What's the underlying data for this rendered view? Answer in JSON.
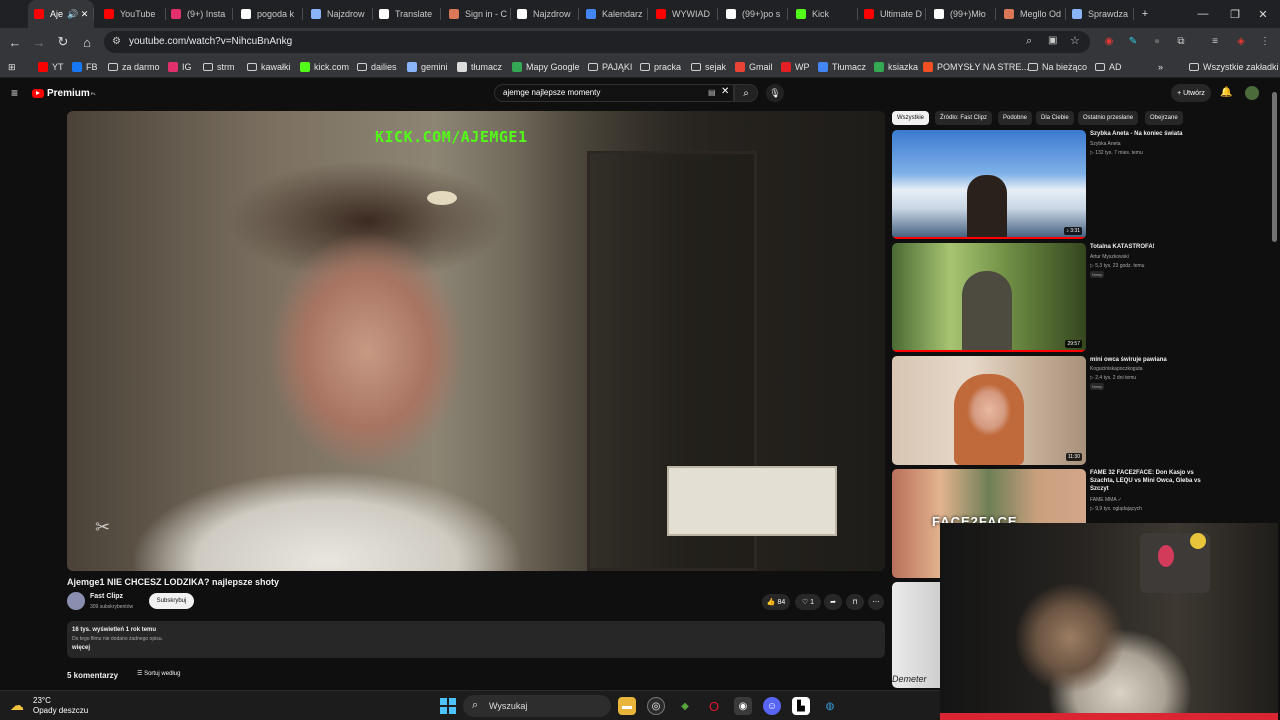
{
  "tabs": [
    {
      "label": "Aje",
      "icon": "youtube-icon",
      "color": "#ff0000",
      "active": true
    },
    {
      "label": "YouTube",
      "icon": "youtube-icon",
      "color": "#ff0000"
    },
    {
      "label": "(9+) Insta",
      "icon": "instagram-icon",
      "color": "#e1306c"
    },
    {
      "label": "pogoda k",
      "icon": "google-icon",
      "color": "#ffffff"
    },
    {
      "label": "Najzdrow",
      "icon": "gemini-icon",
      "color": "#8ab4f8"
    },
    {
      "label": "Translate",
      "icon": "translate-icon",
      "color": "#ffffff"
    },
    {
      "label": "Sign in - C",
      "icon": "claude-icon",
      "color": "#d97757"
    },
    {
      "label": "Najzdrow",
      "icon": "openai-icon",
      "color": "#ffffff"
    },
    {
      "label": "Kalendarz",
      "icon": "calendar-icon",
      "color": "#4285f4"
    },
    {
      "label": "WYWIAD",
      "icon": "youtube-icon",
      "color": "#ff0000"
    },
    {
      "label": "(99+)po s",
      "icon": "tiktok-icon",
      "color": "#ffffff"
    },
    {
      "label": "Kick",
      "icon": "kick-icon",
      "color": "#53fc18"
    },
    {
      "label": "Ultimate D",
      "icon": "youtube-icon",
      "color": "#ff0000"
    },
    {
      "label": "(99+)Mło",
      "icon": "tiktok-icon",
      "color": "#ffffff"
    },
    {
      "label": "Megllo Od",
      "icon": "claude-icon",
      "color": "#d97757"
    },
    {
      "label": "Sprawdza",
      "icon": "gemini-icon",
      "color": "#8ab4f8"
    }
  ],
  "new_tab": "+",
  "address": {
    "url": "youtube.com/watch?v=NihcuBnAnkg"
  },
  "bookmarks": [
    {
      "label": "YT",
      "icon": "youtube-icon",
      "color": "#ff0000"
    },
    {
      "label": "FB",
      "icon": "facebook-icon",
      "color": "#1877f2"
    },
    {
      "label": "za darmo",
      "icon": "folder-icon",
      "color": ""
    },
    {
      "label": "IG",
      "icon": "instagram-icon",
      "color": "#e1306c"
    },
    {
      "label": "strm",
      "icon": "folder-icon",
      "color": ""
    },
    {
      "label": "kawałki",
      "icon": "folder-icon",
      "color": ""
    },
    {
      "label": "kick.com",
      "icon": "kick-icon",
      "color": "#53fc18"
    },
    {
      "label": "dailies",
      "icon": "folder-icon",
      "color": ""
    },
    {
      "label": "gemini",
      "icon": "gemini-icon",
      "color": "#8ab4f8"
    },
    {
      "label": "tłumacz",
      "icon": "translate-icon",
      "color": "#dddddd"
    },
    {
      "label": "Mapy Google",
      "icon": "maps-icon",
      "color": "#34a853"
    },
    {
      "label": "PAJĄKI",
      "icon": "folder-icon",
      "color": ""
    },
    {
      "label": "pracka",
      "icon": "folder-icon",
      "color": ""
    },
    {
      "label": "sejak",
      "icon": "folder-icon",
      "color": ""
    },
    {
      "label": "Gmail",
      "icon": "gmail-icon",
      "color": "#ea4335"
    },
    {
      "label": "WP",
      "icon": "wp-icon",
      "color": "#e31e24"
    },
    {
      "label": "Tłumacz",
      "icon": "translate-icon",
      "color": "#4285f4"
    },
    {
      "label": "ksiazka",
      "icon": "book-icon",
      "color": "#34a853"
    },
    {
      "label": "POMYSŁY NA STRE...",
      "icon": "microsoft-icon",
      "color": "#f25022"
    },
    {
      "label": "Na bieżąco",
      "icon": "folder-icon",
      "color": ""
    },
    {
      "label": "AD",
      "icon": "folder-icon",
      "color": ""
    }
  ],
  "bookmarks_more": "»",
  "all_bookmarks": "Wszystkie zakładki",
  "youtube": {
    "logo": "Premium",
    "logo_sup": "PL",
    "search_query": "ajemge najlepsze momenty",
    "create_label": "Utwórz"
  },
  "video": {
    "overlay_text": "KICK.COM/AJEMGE1",
    "title": "Ajemge1 NIE CHCESZ LODZIKA? najlepsze shoty",
    "channel": "Fast Clipz",
    "subscribers": "309 subskrybentów",
    "subscribe_label": "Subskrybuj",
    "likes": "84",
    "dislikes": "1",
    "views_line": "16 tys. wyświetleń  1 rok temu",
    "description": "Do tego filmu nie dodano żadnego opisu.",
    "more_label": "więcej",
    "comments_count": "5 komentarzy",
    "sort_label": "Sortuj według"
  },
  "chips": [
    {
      "label": "Wszystkie",
      "active": true
    },
    {
      "label": "Źródło: Fast Clipz"
    },
    {
      "label": "Podobne"
    },
    {
      "label": "Dla Ciebie"
    },
    {
      "label": "Ostatnio przesłane"
    },
    {
      "label": "Obejrzane"
    }
  ],
  "recommendations": [
    {
      "title": "Szybka Aneta - Na koniec świata",
      "channel": "Szybka Aneta",
      "meta": "▷ 132 tys.   7 mies. temu",
      "duration": "♪ 3:31",
      "badge": ""
    },
    {
      "title": "Totalna KATASTROFA!",
      "channel": "Artur Myszkowski",
      "meta": "▷ 5,3 tys.   23 godz. temu",
      "duration": "29:57",
      "badge": "Nowy"
    },
    {
      "title": "mini owca świruje pawiana",
      "channel": "Koguciniskapoczkoguta",
      "meta": "▷ 2,4 tys.   2 dni temu",
      "duration": "11:30",
      "badge": "Nowy"
    },
    {
      "title": "FAME 32 FACE2FACE: Don Kasjo vs Szachta, LEQU vs Mini Owca, Gleba vs Szczyt",
      "channel": "FAME MMA ✓",
      "meta": "▷ 9,9 tys. oglądających",
      "duration": "",
      "badge": ""
    }
  ],
  "thumb_texts": {
    "fame": "FACE2FACE",
    "demeter": "Demeter"
  },
  "taskbar": {
    "temperature": "23°C",
    "weather": "Opady deszczu",
    "search_label": "Wyszukaj"
  }
}
